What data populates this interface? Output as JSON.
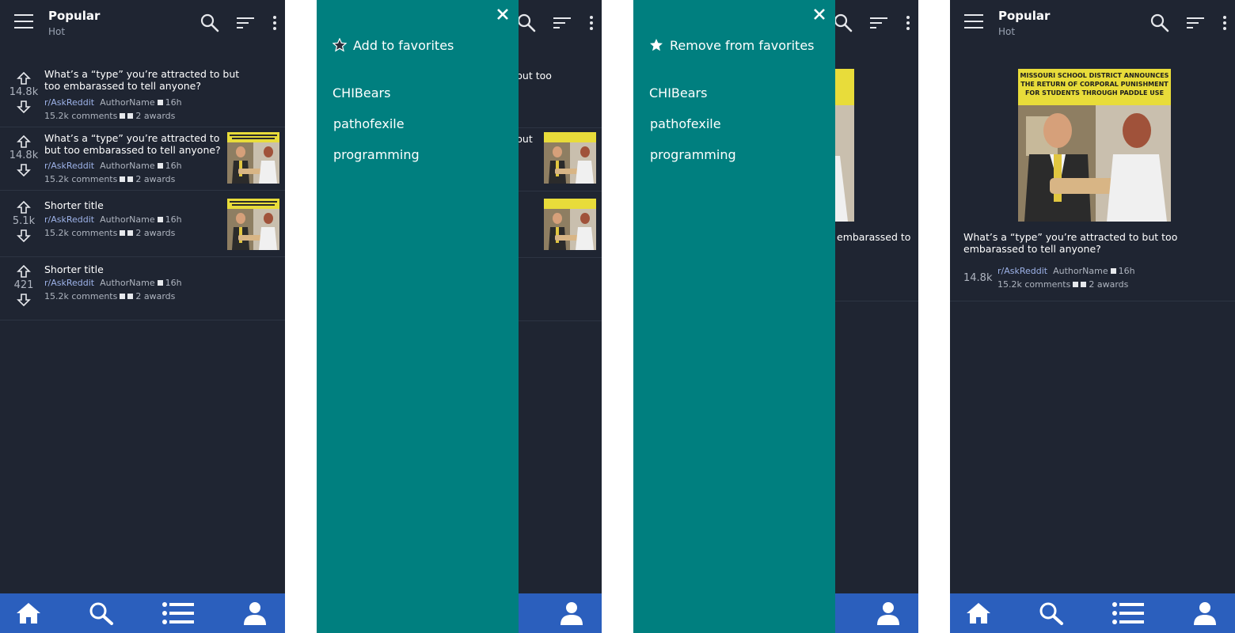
{
  "header": {
    "title": "Popular",
    "subtitle": "Hot"
  },
  "posts": [
    {
      "title": "What’s a “type” you’re attracted to but too embarassed to tell anyone?",
      "score": "14.8k",
      "subreddit": "r/AskReddit",
      "author": "AuthorName",
      "age": "16h",
      "comments": "15.2k comments",
      "awards": "2 awards",
      "has_thumb": false
    },
    {
      "title": "What’s a “type” you’re attracted to but too embarassed to tell anyone?",
      "score": "14.8k",
      "subreddit": "r/AskReddit",
      "author": "AuthorName",
      "age": "16h",
      "comments": "15.2k comments",
      "awards": "2 awards",
      "has_thumb": true
    },
    {
      "title": "Shorter title",
      "score": "5.1k",
      "subreddit": "r/AskReddit",
      "author": "AuthorName",
      "age": "16h",
      "comments": "15.2k comments",
      "awards": "2 awards",
      "has_thumb": true
    },
    {
      "title": "Shorter title",
      "score": "421",
      "subreddit": "r/AskReddit",
      "author": "AuthorName",
      "age": "16h",
      "comments": "15.2k comments",
      "awards": "2 awards",
      "has_thumb": false
    }
  ],
  "thumbnail_caption": "MISSOURI SCHOOL DISTRICT ANNOUNCES THE RETURN OF CORPORAL PUNISHMENT FOR STUDENTS THROUGH PADDLE USE",
  "drawer_add": {
    "favorite_action": "Add to favorites",
    "items": [
      "CHIBears",
      "pathofexile",
      "programming"
    ]
  },
  "drawer_remove": {
    "favorite_action": "Remove from favorites",
    "items": [
      "CHIBears",
      "pathofexile",
      "programming"
    ]
  },
  "behind_fragments": {
    "title_tail": "but too",
    "title_tail2": "but",
    "detail_title_tail": "embarassed to"
  },
  "detail": {
    "title": "What’s a “type” you’re attracted to but too embarassed to tell anyone?",
    "score": "14.8k",
    "subreddit": "r/AskReddit",
    "author": "AuthorName",
    "age": "16h",
    "comments": "15.2k comments",
    "awards": "2 awards"
  },
  "bottom_nav": [
    "home",
    "search",
    "list",
    "profile"
  ],
  "colors": {
    "background": "#1f2532",
    "drawer": "#007f7f",
    "navbar": "#2b5fbd",
    "subreddit": "#9db2e8"
  }
}
